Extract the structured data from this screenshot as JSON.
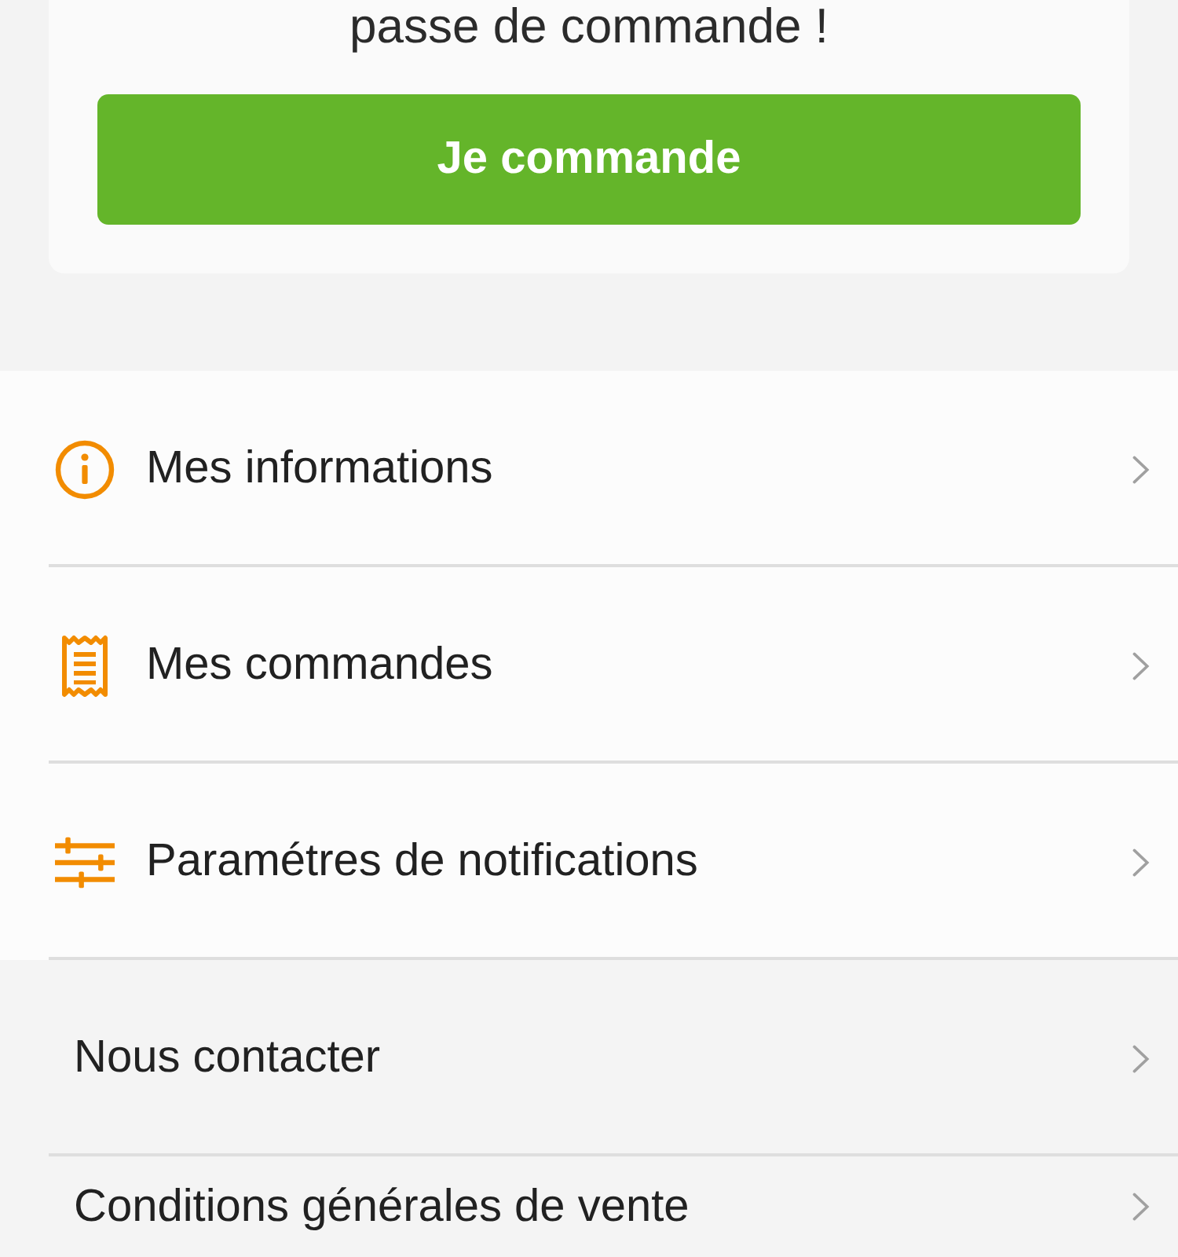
{
  "order_card": {
    "message": "passe de commande !",
    "button": "Je commande"
  },
  "account_menu": {
    "items": [
      {
        "kind": "info",
        "label": "Mes informations"
      },
      {
        "kind": "orders",
        "label": "Mes commandes"
      },
      {
        "kind": "notifications",
        "label": "Paramétres de notifications"
      }
    ]
  },
  "info_menu": {
    "items": [
      {
        "label": "Nous contacter"
      },
      {
        "label": "Conditions générales de vente"
      }
    ]
  }
}
